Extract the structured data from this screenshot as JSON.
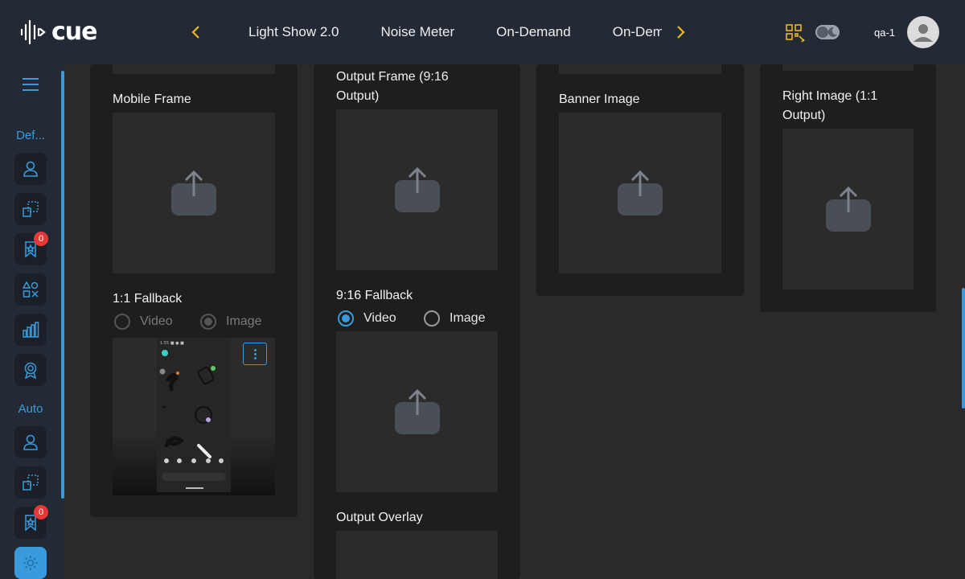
{
  "brand": {
    "name": "cue"
  },
  "nav": {
    "prev_icon": "chevron-left-icon",
    "next_icon": "chevron-right-icon",
    "tabs": [
      "Light Show 2.0",
      "Noise Meter",
      "On-Demand",
      "On-Demand"
    ]
  },
  "header": {
    "user": "qa-1"
  },
  "sidebar": {
    "sections": [
      {
        "label": "Def...",
        "items": [
          {
            "icon": "user-icon"
          },
          {
            "icon": "select-icon"
          },
          {
            "icon": "bookmark-star-icon",
            "badge": "0"
          },
          {
            "icon": "shapes-icon"
          },
          {
            "icon": "bar-chart-icon"
          },
          {
            "icon": "award-icon"
          }
        ]
      },
      {
        "label": "Auto",
        "items": [
          {
            "icon": "user-icon"
          },
          {
            "icon": "select-icon"
          },
          {
            "icon": "bookmark-star-icon",
            "badge": "0"
          },
          {
            "icon": "gear-icon"
          }
        ]
      }
    ]
  },
  "columns": {
    "col1": {
      "mobile_frame_label": "Mobile Frame",
      "fallback_label": "1:1 Fallback",
      "radio_video": "Video",
      "radio_image": "Image",
      "selected": "Image",
      "disabled": true
    },
    "col2": {
      "output_frame_label": "Output Frame (9:16 Output)",
      "fallback_label": "9:16 Fallback",
      "radio_video": "Video",
      "radio_image": "Image",
      "selected": "Video",
      "overlay_label": "Output Overlay"
    },
    "col3": {
      "banner_label": "Banner Image"
    },
    "col4": {
      "right_image_label": "Right Image (1:1 Output)"
    }
  },
  "colors": {
    "accent": "#3a9bdc",
    "brand_yellow": "#e8b923",
    "badge": "#e53935",
    "topbar": "#232a36"
  }
}
